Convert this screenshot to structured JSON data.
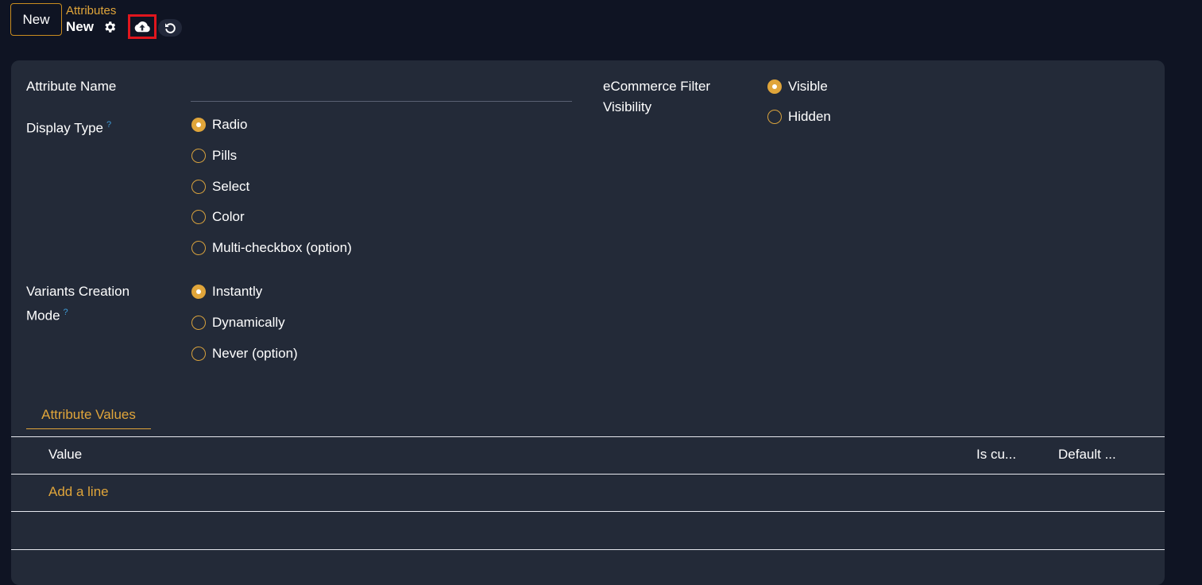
{
  "control_panel": {
    "new_button": "New",
    "breadcrumb_parent": "Attributes",
    "breadcrumb_current": "New"
  },
  "form": {
    "attribute_name": {
      "label": "Attribute Name",
      "value": ""
    },
    "display_type": {
      "label": "Display Type",
      "help": "?",
      "options": [
        "Radio",
        "Pills",
        "Select",
        "Color",
        "Multi-checkbox (option)"
      ],
      "selected": "Radio"
    },
    "variants_creation_mode": {
      "label_line1": "Variants Creation",
      "label_line2": "Mode",
      "help": "?",
      "options": [
        "Instantly",
        "Dynamically",
        "Never (option)"
      ],
      "selected": "Instantly"
    },
    "ecommerce_filter_visibility": {
      "label_line1": "eCommerce Filter",
      "label_line2": "Visibility",
      "options": [
        "Visible",
        "Hidden"
      ],
      "selected": "Visible"
    }
  },
  "notebook": {
    "tab_label": "Attribute Values",
    "columns": [
      "Value",
      "Is cu...",
      "Default ..."
    ],
    "add_line": "Add a line"
  },
  "colors": {
    "accent": "#e0a53a",
    "background": "#0f1423",
    "sheet": "#232a38",
    "highlight_border": "#e0161d"
  }
}
